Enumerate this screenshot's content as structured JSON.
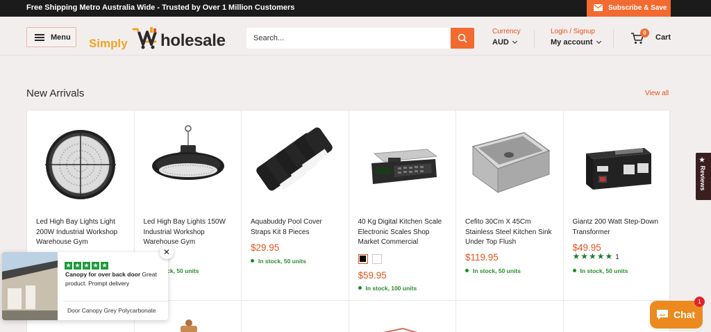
{
  "announcement": {
    "text": "Free Shipping Metro Australia Wide - Trusted by Over 1 Million Customers",
    "subscribe_label": "Subscribe & Save"
  },
  "header": {
    "menu_label": "Menu",
    "logo_prefix": "Simply",
    "logo_suffix": "holesale",
    "search_placeholder": "Search...",
    "currency_label": "Currency",
    "currency_value": "AUD",
    "login_label": "Login / Signup",
    "account_label": "My account",
    "cart_count": "0",
    "cart_label": "Cart"
  },
  "section": {
    "title": "New Arrivals",
    "view_all": "View all"
  },
  "products": [
    {
      "name": "Led High Bay Lights Light 200W Industrial Workshop Warehouse Gym",
      "price": "",
      "stock": ""
    },
    {
      "name": "Led High Bay Lights 150W Industrial Workshop Warehouse Gym",
      "price": "",
      "stock": "In stock, 50 units"
    },
    {
      "name": "Aquabuddy Pool Cover Straps Kit 8 Pieces",
      "price": "$29.95",
      "stock": "In stock, 50 units"
    },
    {
      "name": "40 Kg Digital Kitchen Scale Electronic Scales Shop Market Commercial",
      "price": "$59.95",
      "stock": "In stock, 100 units"
    },
    {
      "name": "Cefito 30Cm X 45Cm Stainless Steel Kitchen Sink Under Top Flush",
      "price": "$119.95",
      "stock": "In stock, 50 units"
    },
    {
      "name": "Giantz 200 Watt Step-Down Transformer",
      "price": "$49.95",
      "stock": "In stock, 50 units",
      "rating": 5,
      "review_count": "1"
    }
  ],
  "reviews_tab": "★ Reviews",
  "review_popup": {
    "rating": 5,
    "title": "Canopy for over back door",
    "body": "Great product. Prompt delivery",
    "product": "Door Canopy Grey Polycarbonate",
    "close": "✕"
  },
  "chat": {
    "label": "Chat",
    "badge": "1"
  },
  "colors": {
    "accent": "#f26a2f",
    "price": "#e3521c",
    "stock": "#2c8c2c",
    "chat": "#ec8a1f"
  }
}
